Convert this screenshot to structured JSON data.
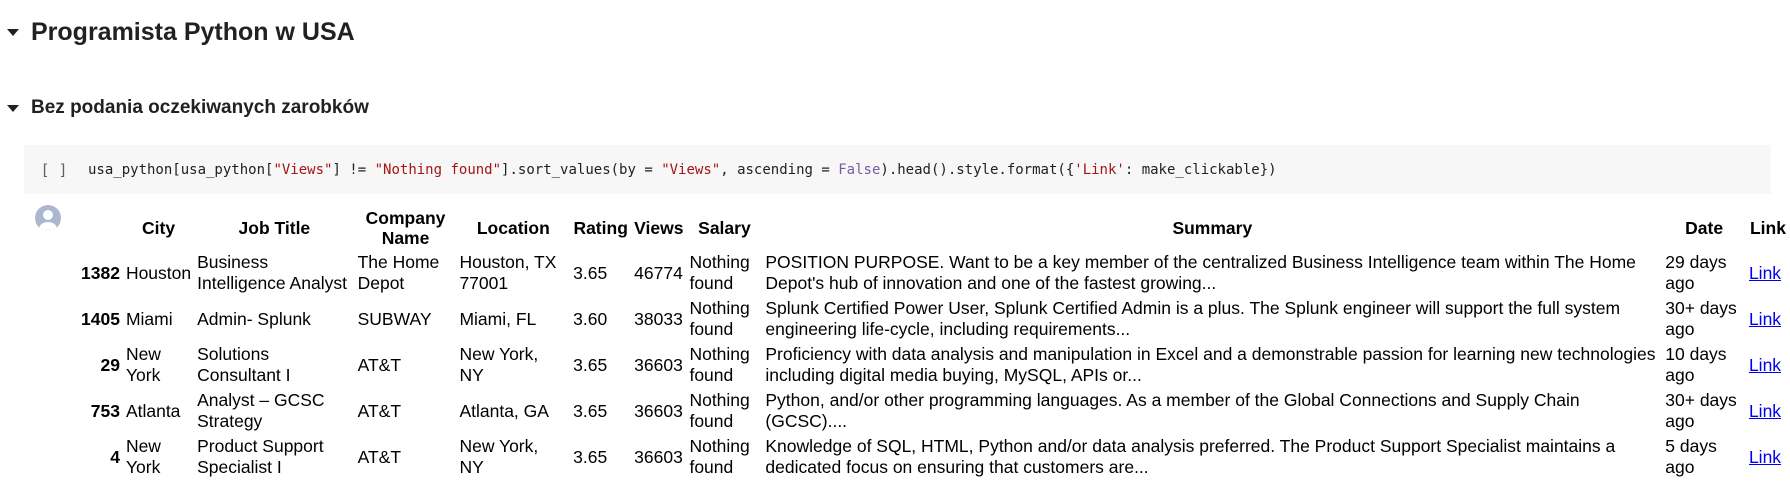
{
  "heading1": "Programista Python w USA",
  "heading2": "Bez podania oczekiwanych zarobków",
  "cell": {
    "run_label": "[ ]",
    "code": {
      "p1": "usa_python[usa_python[",
      "s1": "\"Views\"",
      "p2": "] != ",
      "s2": "\"Nothing found\"",
      "p3": "].sort_values(by = ",
      "s3": "\"Views\"",
      "p4": ", ascending = ",
      "k1": "False",
      "p5": ").head().style.format({",
      "s4": "'Link'",
      "p6": ": make_clickable})"
    }
  },
  "output": {
    "avatar_icon": "user-avatar-icon",
    "columns": [
      "City",
      "Job Title",
      "Company Name",
      "Location",
      "Rating",
      "Views",
      "Salary",
      "Summary",
      "Date",
      "Link"
    ],
    "rows": [
      {
        "index": "1382",
        "city": "Houston",
        "title": "Business Intelligence Analyst",
        "company": "The Home Depot",
        "location": "Houston, TX 77001",
        "rating": "3.65",
        "views": "46774",
        "salary": "Nothing found",
        "summary": "POSITION PURPOSE. Want to be a key member of the centralized Business Intelligence team within The Home Depot's hub of innovation and one of the fastest growing...",
        "date": "29 days ago",
        "link": "Link"
      },
      {
        "index": "1405",
        "city": "Miami",
        "title": "Admin- Splunk",
        "company": "SUBWAY",
        "location": "Miami, FL",
        "rating": "3.60",
        "views": "38033",
        "salary": "Nothing found",
        "summary": "Splunk Certified Power User, Splunk Certified Admin is a plus. The Splunk engineer will support the full system engineering life-cycle, including requirements...",
        "date": "30+ days ago",
        "link": "Link"
      },
      {
        "index": "29",
        "city": "New York",
        "title": "Solutions Consultant I",
        "company": "AT&T",
        "location": "New York, NY",
        "rating": "3.65",
        "views": "36603",
        "salary": "Nothing found",
        "summary": "Proficiency with data analysis and manipulation in Excel and a demonstrable passion for learning new technologies including digital media buying, MySQL, APIs or...",
        "date": "10 days ago",
        "link": "Link"
      },
      {
        "index": "753",
        "city": "Atlanta",
        "title": "Analyst – GCSC Strategy",
        "company": "AT&T",
        "location": "Atlanta, GA",
        "rating": "3.65",
        "views": "36603",
        "salary": "Nothing found",
        "summary": "Python, and/or other programming languages. As a member of the Global Connections and Supply Chain (GCSC)....",
        "date": "30+ days ago",
        "link": "Link"
      },
      {
        "index": "4",
        "city": "New York",
        "title": "Product Support Specialist I",
        "company": "AT&T",
        "location": "New York, NY",
        "rating": "3.65",
        "views": "36603",
        "salary": "Nothing found",
        "summary": "Knowledge of SQL, HTML, Python and/or data analysis preferred. The Product Support Specialist maintains a dedicated focus on ensuring that customers are...",
        "date": "5 days ago",
        "link": "Link"
      }
    ]
  }
}
